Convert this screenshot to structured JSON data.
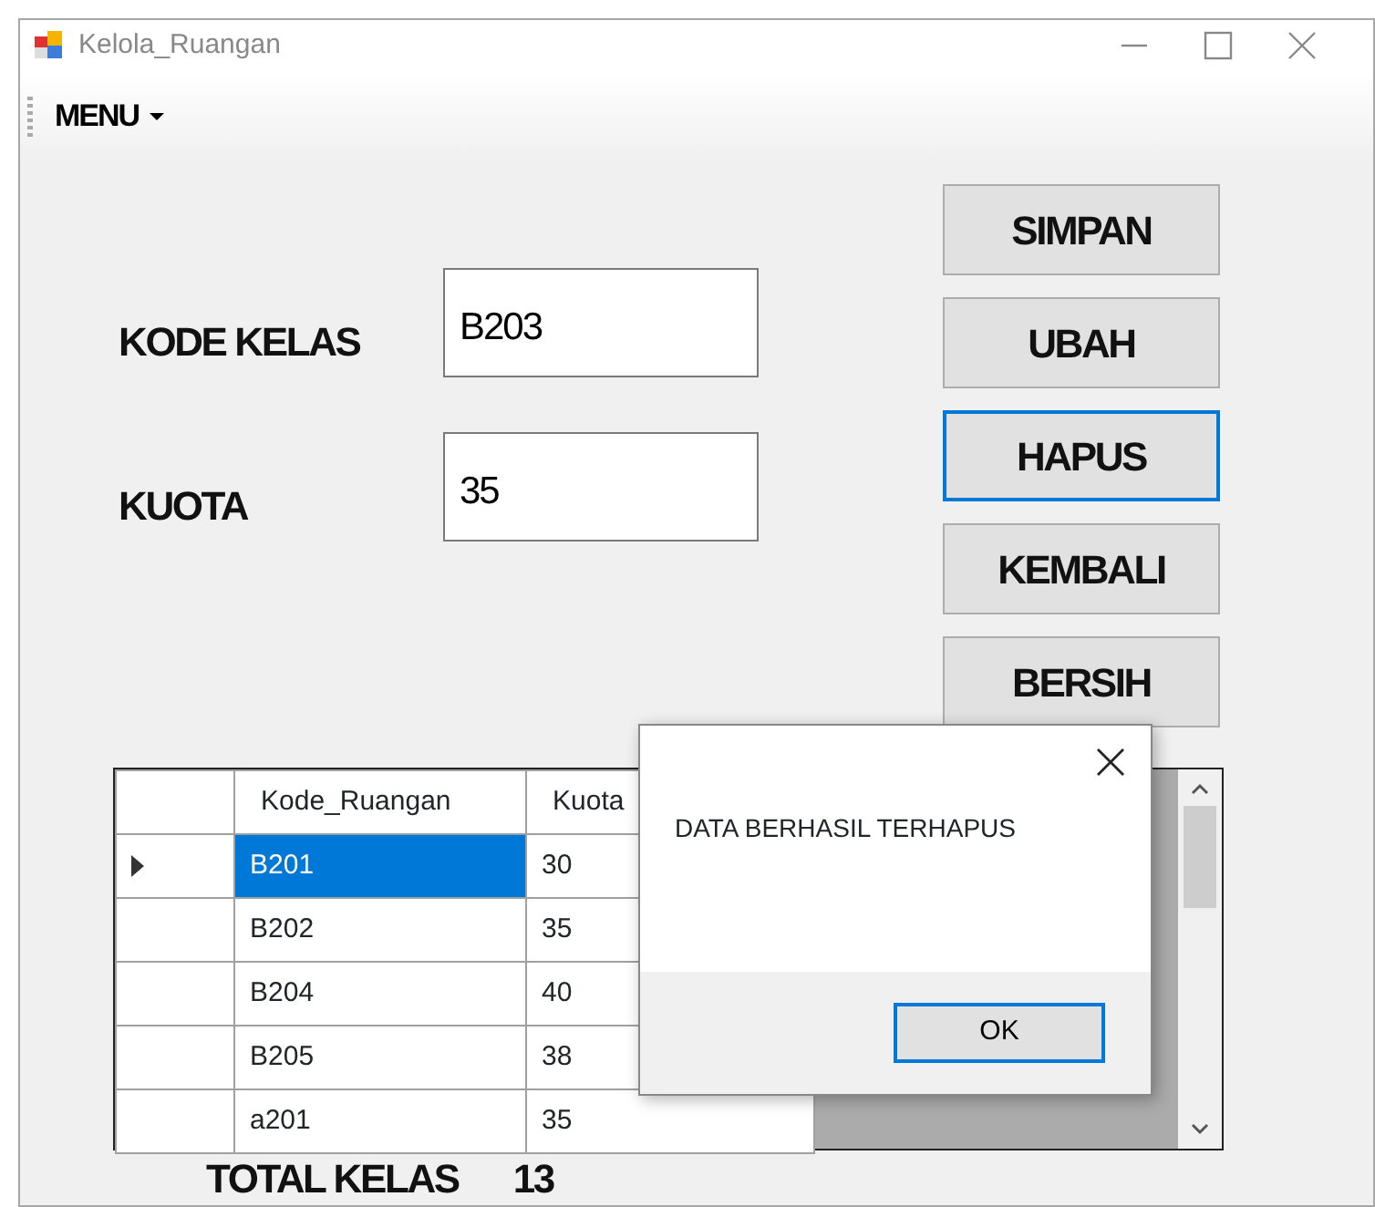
{
  "window": {
    "title": "Kelola_Ruangan"
  },
  "menu": {
    "label": "MENU"
  },
  "fields": [
    {
      "label": "KODE KELAS",
      "value": "B203"
    },
    {
      "label": "KUOTA",
      "value": "35"
    }
  ],
  "buttons": [
    {
      "label": "SIMPAN",
      "focused": false
    },
    {
      "label": "UBAH",
      "focused": false
    },
    {
      "label": "HAPUS",
      "focused": true
    },
    {
      "label": "KEMBALI",
      "focused": false
    },
    {
      "label": "BERSIH",
      "focused": false
    }
  ],
  "table": {
    "columns": [
      "Kode_Ruangan",
      "Kuota"
    ],
    "rows": [
      {
        "cells": [
          "B201",
          "30"
        ],
        "selected": true
      },
      {
        "cells": [
          "B202",
          "35"
        ],
        "selected": false
      },
      {
        "cells": [
          "B204",
          "40"
        ],
        "selected": false
      },
      {
        "cells": [
          "B205",
          "38"
        ],
        "selected": false
      },
      {
        "cells": [
          "a201",
          "35"
        ],
        "selected": false
      }
    ]
  },
  "total": {
    "label": "TOTAL KELAS",
    "value": "13"
  },
  "dialog": {
    "message": "DATA BERHASIL TERHAPUS",
    "button": "OK"
  }
}
